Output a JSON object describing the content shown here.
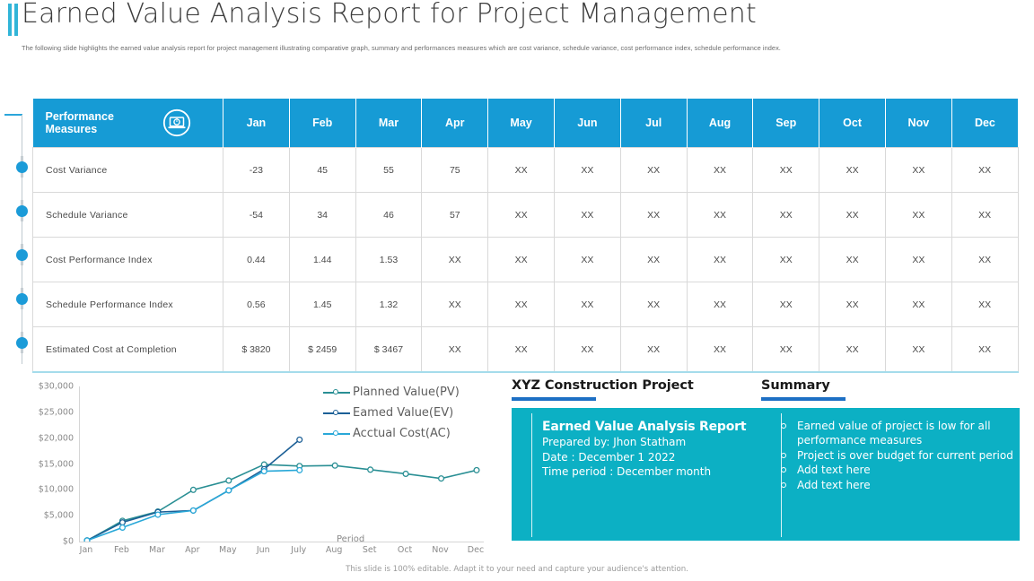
{
  "header": {
    "title": "Earned Value Analysis Report for Project Management",
    "subtitle": "The following slide highlights the earned value analysis report for project management illustrating comparative graph, summary and performances measures which are cost variance, schedule variance, cost performance index, schedule performance index.",
    "accent_color": "#31b5d8"
  },
  "table": {
    "header_bg": "#169bd5",
    "measures_label_line1": "Performance",
    "measures_label_line2": "Measures",
    "icon": "laptop-timer-icon",
    "months": [
      "Jan",
      "Feb",
      "Mar",
      "Apr",
      "May",
      "Jun",
      "Jul",
      "Aug",
      "Sep",
      "Oct",
      "Nov",
      "Dec"
    ],
    "rows": [
      {
        "label": "Cost Variance",
        "values": [
          "-23",
          "45",
          "55",
          "75",
          "XX",
          "XX",
          "XX",
          "XX",
          "XX",
          "XX",
          "XX",
          "XX"
        ]
      },
      {
        "label": "Schedule Variance",
        "values": [
          "-54",
          "34",
          "46",
          "57",
          "XX",
          "XX",
          "XX",
          "XX",
          "XX",
          "XX",
          "XX",
          "XX"
        ]
      },
      {
        "label": "Cost Performance Index",
        "values": [
          "0.44",
          "1.44",
          "1.53",
          "XX",
          "XX",
          "XX",
          "XX",
          "XX",
          "XX",
          "XX",
          "XX",
          "XX"
        ]
      },
      {
        "label": "Schedule Performance Index",
        "values": [
          "0.56",
          "1.45",
          "1.32",
          "XX",
          "XX",
          "XX",
          "XX",
          "XX",
          "XX",
          "XX",
          "XX",
          "XX"
        ]
      },
      {
        "label": "Estimated Cost at Completion",
        "values": [
          "$ 3820",
          "$ 2459",
          "$ 3467",
          "XX",
          "XX",
          "XX",
          "XX",
          "XX",
          "XX",
          "XX",
          "XX",
          "XX"
        ]
      }
    ]
  },
  "chart_data": {
    "type": "line",
    "title": "",
    "xlabel": "Period",
    "ylabel": "",
    "categories": [
      "Jan",
      "Feb",
      "Mar",
      "Apr",
      "May",
      "Jun",
      "July",
      "Aug",
      "Set",
      "Oct",
      "Nov",
      "Dec"
    ],
    "ylim": [
      0,
      30000
    ],
    "yticks": [
      0,
      5000,
      10000,
      15000,
      20000,
      25000,
      30000
    ],
    "ytick_labels": [
      "$0",
      "$5,000",
      "$10,000",
      "$15,000",
      "$20,000",
      "$25,000",
      "$30,000"
    ],
    "grid": false,
    "legend_position": "top-right",
    "series": [
      {
        "name": "Planned Value(PV)",
        "color": "#2a8f94",
        "values": [
          200,
          4000,
          5800,
          10000,
          11800,
          14900,
          14600,
          14700,
          13900,
          13100,
          12200,
          13800
        ]
      },
      {
        "name": "Eamed Value(EV)",
        "color": "#1c5f96",
        "values": [
          200,
          3700,
          5700,
          6000,
          9900,
          14000,
          19700,
          null,
          null,
          null,
          null,
          null
        ]
      },
      {
        "name": "Acctual Cost(AC)",
        "color": "#29a8d8",
        "values": [
          200,
          2700,
          5200,
          6000,
          9900,
          13600,
          13800,
          null,
          null,
          null,
          null,
          null
        ]
      }
    ]
  },
  "panels": {
    "project": {
      "title": "XYZ Construction Project",
      "box_color": "#0cb0c4",
      "underline_color": "#1d6fc4",
      "heading": "Earned Value Analysis Report",
      "lines": [
        "Prepared by: Jhon Statham",
        "Date : December 1 2022",
        "Time period : December month"
      ]
    },
    "summary": {
      "title": "Summary",
      "box_color": "#0cb0c4",
      "underline_color": "#1d6fc4",
      "bullets": [
        "Earned value of project is low for all performance measures",
        "Project is over budget for current period",
        "Add text here",
        "Add text here"
      ]
    }
  },
  "footer": {
    "note": "This slide is 100% editable. Adapt it to your need and capture your audience's attention."
  }
}
